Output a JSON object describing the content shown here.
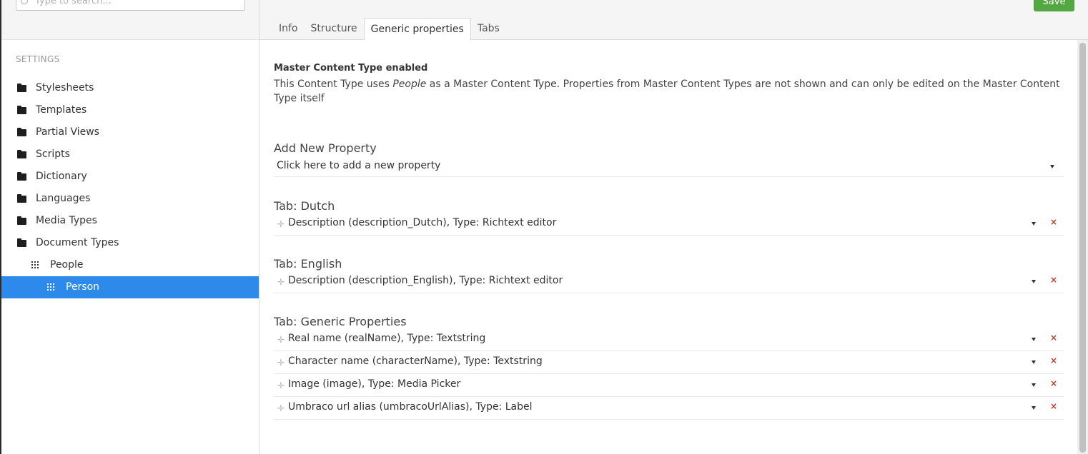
{
  "search": {
    "placeholder": "Type to search..."
  },
  "sidebar": {
    "section_title": "SETTINGS",
    "items": [
      {
        "label": "Stylesheets",
        "icon": "folder-icon"
      },
      {
        "label": "Templates",
        "icon": "folder-icon"
      },
      {
        "label": "Partial Views",
        "icon": "folder-icon"
      },
      {
        "label": "Scripts",
        "icon": "folder-icon"
      },
      {
        "label": "Dictionary",
        "icon": "folder-icon"
      },
      {
        "label": "Languages",
        "icon": "folder-icon"
      },
      {
        "label": "Media Types",
        "icon": "folder-icon"
      },
      {
        "label": "Document Types",
        "icon": "folder-icon"
      },
      {
        "label": "People",
        "icon": "document-type-icon"
      },
      {
        "label": "Person",
        "icon": "document-type-icon",
        "selected": true
      }
    ]
  },
  "header": {
    "tabs": [
      {
        "label": "Info"
      },
      {
        "label": "Structure"
      },
      {
        "label": "Generic properties",
        "active": true
      },
      {
        "label": "Tabs"
      }
    ],
    "save_label": "Save"
  },
  "master": {
    "title": "Master Content Type enabled",
    "desc_before": "This Content Type uses ",
    "desc_name": "People",
    "desc_after": " as a Master Content Type. Properties from Master Content Types are not shown and can only be edited on the Master Content Type itself"
  },
  "add_property": {
    "title": "Add New Property",
    "prompt": "Click here to add a new property"
  },
  "groups": [
    {
      "title": "Tab: Dutch",
      "properties": [
        "Description (description_Dutch), Type: Richtext editor"
      ]
    },
    {
      "title": "Tab: English",
      "properties": [
        "Description (description_English), Type: Richtext editor"
      ]
    },
    {
      "title": "Tab: Generic Properties",
      "properties": [
        "Real name (realName), Type: Textstring",
        "Character name (characterName), Type: Textstring",
        "Image (image), Type: Media Picker",
        "Umbraco url alias (umbracoUrlAlias), Type: Label"
      ]
    }
  ],
  "colors": {
    "accent": "#2e8aea",
    "save": "#53a93f",
    "delete": "#c0392b"
  }
}
